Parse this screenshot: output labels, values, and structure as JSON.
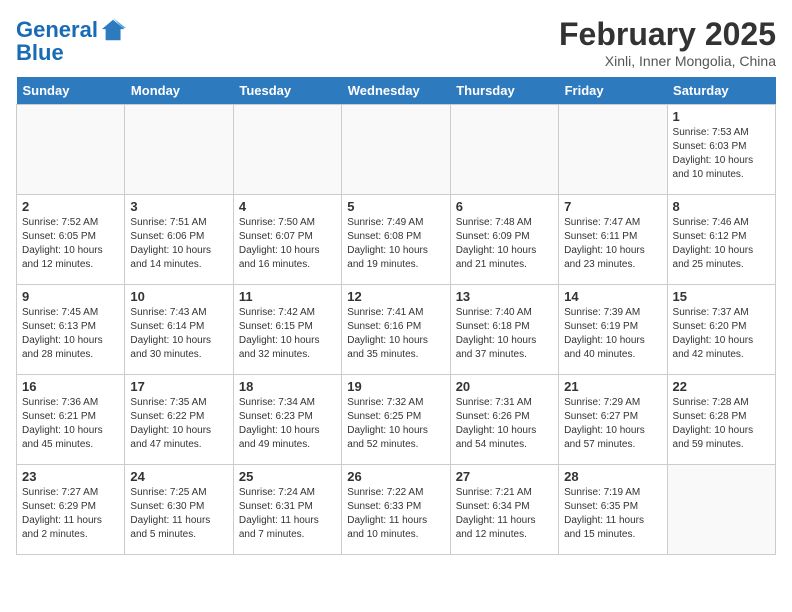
{
  "header": {
    "logo_line1": "General",
    "logo_line2": "Blue",
    "month": "February 2025",
    "location": "Xinli, Inner Mongolia, China"
  },
  "days_of_week": [
    "Sunday",
    "Monday",
    "Tuesday",
    "Wednesday",
    "Thursday",
    "Friday",
    "Saturday"
  ],
  "weeks": [
    [
      {
        "num": "",
        "info": ""
      },
      {
        "num": "",
        "info": ""
      },
      {
        "num": "",
        "info": ""
      },
      {
        "num": "",
        "info": ""
      },
      {
        "num": "",
        "info": ""
      },
      {
        "num": "",
        "info": ""
      },
      {
        "num": "1",
        "info": "Sunrise: 7:53 AM\nSunset: 6:03 PM\nDaylight: 10 hours\nand 10 minutes."
      }
    ],
    [
      {
        "num": "2",
        "info": "Sunrise: 7:52 AM\nSunset: 6:05 PM\nDaylight: 10 hours\nand 12 minutes."
      },
      {
        "num": "3",
        "info": "Sunrise: 7:51 AM\nSunset: 6:06 PM\nDaylight: 10 hours\nand 14 minutes."
      },
      {
        "num": "4",
        "info": "Sunrise: 7:50 AM\nSunset: 6:07 PM\nDaylight: 10 hours\nand 16 minutes."
      },
      {
        "num": "5",
        "info": "Sunrise: 7:49 AM\nSunset: 6:08 PM\nDaylight: 10 hours\nand 19 minutes."
      },
      {
        "num": "6",
        "info": "Sunrise: 7:48 AM\nSunset: 6:09 PM\nDaylight: 10 hours\nand 21 minutes."
      },
      {
        "num": "7",
        "info": "Sunrise: 7:47 AM\nSunset: 6:11 PM\nDaylight: 10 hours\nand 23 minutes."
      },
      {
        "num": "8",
        "info": "Sunrise: 7:46 AM\nSunset: 6:12 PM\nDaylight: 10 hours\nand 25 minutes."
      }
    ],
    [
      {
        "num": "9",
        "info": "Sunrise: 7:45 AM\nSunset: 6:13 PM\nDaylight: 10 hours\nand 28 minutes."
      },
      {
        "num": "10",
        "info": "Sunrise: 7:43 AM\nSunset: 6:14 PM\nDaylight: 10 hours\nand 30 minutes."
      },
      {
        "num": "11",
        "info": "Sunrise: 7:42 AM\nSunset: 6:15 PM\nDaylight: 10 hours\nand 32 minutes."
      },
      {
        "num": "12",
        "info": "Sunrise: 7:41 AM\nSunset: 6:16 PM\nDaylight: 10 hours\nand 35 minutes."
      },
      {
        "num": "13",
        "info": "Sunrise: 7:40 AM\nSunset: 6:18 PM\nDaylight: 10 hours\nand 37 minutes."
      },
      {
        "num": "14",
        "info": "Sunrise: 7:39 AM\nSunset: 6:19 PM\nDaylight: 10 hours\nand 40 minutes."
      },
      {
        "num": "15",
        "info": "Sunrise: 7:37 AM\nSunset: 6:20 PM\nDaylight: 10 hours\nand 42 minutes."
      }
    ],
    [
      {
        "num": "16",
        "info": "Sunrise: 7:36 AM\nSunset: 6:21 PM\nDaylight: 10 hours\nand 45 minutes."
      },
      {
        "num": "17",
        "info": "Sunrise: 7:35 AM\nSunset: 6:22 PM\nDaylight: 10 hours\nand 47 minutes."
      },
      {
        "num": "18",
        "info": "Sunrise: 7:34 AM\nSunset: 6:23 PM\nDaylight: 10 hours\nand 49 minutes."
      },
      {
        "num": "19",
        "info": "Sunrise: 7:32 AM\nSunset: 6:25 PM\nDaylight: 10 hours\nand 52 minutes."
      },
      {
        "num": "20",
        "info": "Sunrise: 7:31 AM\nSunset: 6:26 PM\nDaylight: 10 hours\nand 54 minutes."
      },
      {
        "num": "21",
        "info": "Sunrise: 7:29 AM\nSunset: 6:27 PM\nDaylight: 10 hours\nand 57 minutes."
      },
      {
        "num": "22",
        "info": "Sunrise: 7:28 AM\nSunset: 6:28 PM\nDaylight: 10 hours\nand 59 minutes."
      }
    ],
    [
      {
        "num": "23",
        "info": "Sunrise: 7:27 AM\nSunset: 6:29 PM\nDaylight: 11 hours\nand 2 minutes."
      },
      {
        "num": "24",
        "info": "Sunrise: 7:25 AM\nSunset: 6:30 PM\nDaylight: 11 hours\nand 5 minutes."
      },
      {
        "num": "25",
        "info": "Sunrise: 7:24 AM\nSunset: 6:31 PM\nDaylight: 11 hours\nand 7 minutes."
      },
      {
        "num": "26",
        "info": "Sunrise: 7:22 AM\nSunset: 6:33 PM\nDaylight: 11 hours\nand 10 minutes."
      },
      {
        "num": "27",
        "info": "Sunrise: 7:21 AM\nSunset: 6:34 PM\nDaylight: 11 hours\nand 12 minutes."
      },
      {
        "num": "28",
        "info": "Sunrise: 7:19 AM\nSunset: 6:35 PM\nDaylight: 11 hours\nand 15 minutes."
      },
      {
        "num": "",
        "info": ""
      }
    ]
  ]
}
